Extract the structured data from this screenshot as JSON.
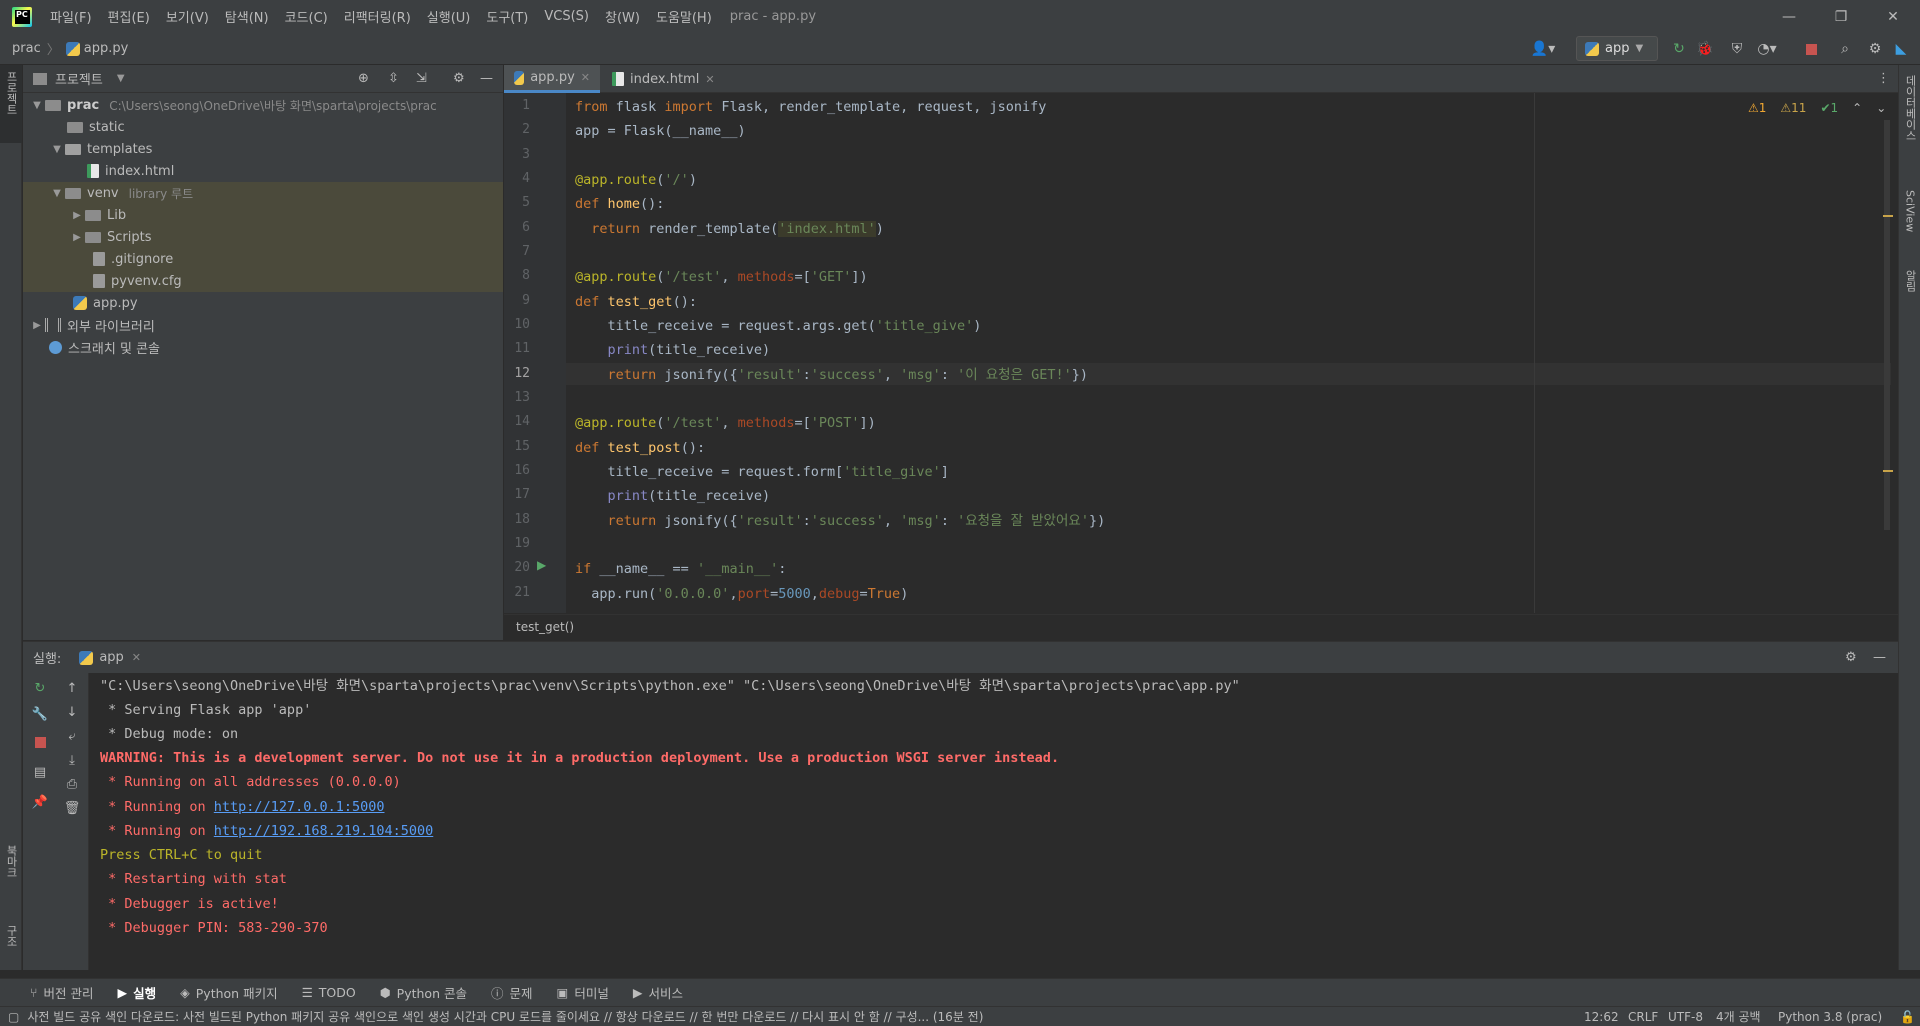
{
  "menubar": {
    "items": [
      "파일(F)",
      "편집(E)",
      "보기(V)",
      "탐색(N)",
      "코드(C)",
      "리팩터링(R)",
      "실행(U)",
      "도구(T)",
      "VCS(S)",
      "창(W)",
      "도움말(H)"
    ],
    "window_title": "prac - app.py"
  },
  "navbar": {
    "project": "prac",
    "file": "app.py"
  },
  "toolbar": {
    "run_config": "app"
  },
  "left_strip": {
    "project_label": "프로젝트",
    "bookmarks_label": "북마크",
    "structure_label": "구조"
  },
  "right_strip": {
    "database_label": "데이터베이스",
    "sciview_label": "SciView",
    "notifications_label": "알림"
  },
  "project_panel": {
    "title": "프로젝트",
    "tree": [
      {
        "label": "prac",
        "hint": "C:\\Users\\seong\\OneDrive\\바탕 화면\\sparta\\projects\\prac"
      },
      {
        "label": "static"
      },
      {
        "label": "templates"
      },
      {
        "label": "index.html"
      },
      {
        "label": "venv",
        "hint": "library 루트"
      },
      {
        "label": "Lib"
      },
      {
        "label": "Scripts"
      },
      {
        "label": ".gitignore"
      },
      {
        "label": "pyvenv.cfg"
      },
      {
        "label": "app.py"
      },
      {
        "label": "외부 라이브러리"
      },
      {
        "label": "스크래치 및 콘솔"
      }
    ]
  },
  "editor": {
    "tabs": [
      {
        "label": "app.py"
      },
      {
        "label": "index.html"
      }
    ],
    "inspections": {
      "warnings1": "1",
      "warnings2": "11",
      "ok": "1"
    },
    "line_numbers": [
      "1",
      "2",
      "3",
      "4",
      "5",
      "6",
      "7",
      "8",
      "9",
      "10",
      "11",
      "12",
      "13",
      "14",
      "15",
      "16",
      "17",
      "18",
      "19",
      "20",
      "21"
    ],
    "breadcrumb": "test_get()"
  },
  "run_panel": {
    "label": "실행:",
    "tab": "app",
    "console": [
      "\"C:\\Users\\seong\\OneDrive\\바탕 화면\\sparta\\projects\\prac\\venv\\Scripts\\python.exe\" \"C:\\Users\\seong\\OneDrive\\바탕 화면\\sparta\\projects\\prac\\app.py\"",
      " * Serving Flask app 'app'",
      " * Debug mode: on",
      "WARNING: This is a development server. Do not use it in a production deployment. Use a production WSGI server instead.",
      " * Running on all addresses (0.0.0.0)",
      " * Running on ",
      "http://127.0.0.1:5000",
      " * Running on ",
      "http://192.168.219.104:5000",
      "Press CTRL+C to quit",
      " * Restarting with stat",
      " * Debugger is active!",
      " * Debugger PIN: 583-290-370"
    ]
  },
  "bottom_tabs": [
    "버전 관리",
    "실행",
    "Python 패키지",
    "TODO",
    "Python 콘솔",
    "문제",
    "터미널",
    "서비스"
  ],
  "statusbar": {
    "message": "사전 빌드 공유 색인 다운로드: 사전 빌드된 Python 패키지 공유 색인으로 색인 생성 시간과 CPU 로드를 줄이세요 // 항상 다운로드 // 한 번만 다운로드 // 다시 표시 안 함 // 구성... (16분 전)",
    "position": "12:62",
    "line_sep": "CRLF",
    "encoding": "UTF-8",
    "indent": "4개 공백",
    "interpreter": "Python 3.8 (prac)"
  }
}
